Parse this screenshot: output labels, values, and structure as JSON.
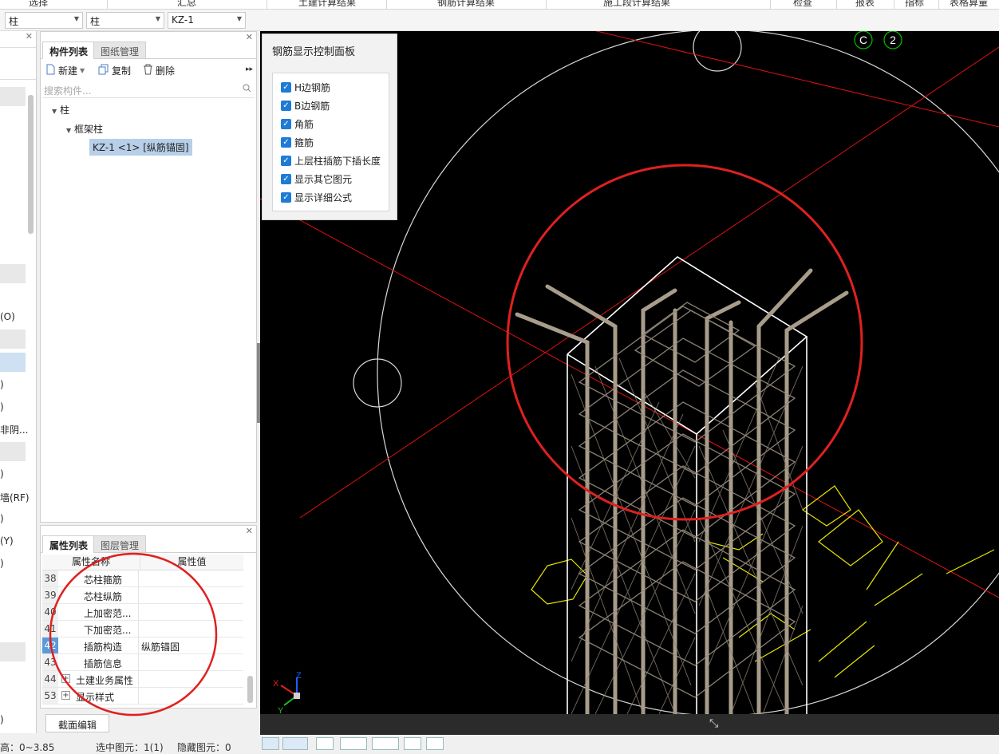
{
  "ribbon": {
    "items": [
      "选择",
      "汇总",
      "土建计算结果",
      "钢筋计算结果",
      "施工段计算结果",
      "检查",
      "报表",
      "指标",
      "表格算量"
    ]
  },
  "combos": {
    "floor": "柱",
    "type": "柱",
    "component": "KZ-1"
  },
  "left_panel": {
    "items": [
      "(O)",
      ")",
      ")",
      "非阴...",
      ")",
      "墙(RF)",
      ")",
      "(Y)",
      ")",
      ")"
    ]
  },
  "component_list": {
    "tabs": [
      "构件列表",
      "图纸管理"
    ],
    "toolbar": {
      "new": "新建",
      "copy": "复制",
      "delete": "删除",
      "more": "▸▸"
    },
    "search_placeholder": "搜索构件...",
    "tree": {
      "root": "柱",
      "child": "框架柱",
      "leaf": "KZ-1 <1> [纵筋锚固]"
    }
  },
  "properties": {
    "tabs": [
      "属性列表",
      "图层管理"
    ],
    "headers": {
      "name": "属性名称",
      "value": "属性值"
    },
    "rows": [
      {
        "num": "38",
        "name": "芯柱箍筋",
        "value": ""
      },
      {
        "num": "39",
        "name": "芯柱纵筋",
        "value": ""
      },
      {
        "num": "40",
        "name": "上加密范...",
        "value": ""
      },
      {
        "num": "41",
        "name": "下加密范...",
        "value": ""
      },
      {
        "num": "42",
        "name": "插筋构造",
        "value": "纵筋锚固"
      },
      {
        "num": "43",
        "name": "插筋信息",
        "value": ""
      },
      {
        "num": "44",
        "name": "土建业务属性",
        "value": ""
      },
      {
        "num": "53",
        "name": "显示样式",
        "value": ""
      }
    ]
  },
  "section_edit_label": "截面编辑",
  "control_panel": {
    "title": "钢筋显示控制面板",
    "options": [
      "H边钢筋",
      "B边钢筋",
      "角筋",
      "箍筋",
      "上层柱插筋下插长度",
      "显示其它图元",
      "显示详细公式"
    ]
  },
  "viewport": {
    "axis_labels": [
      "C",
      "2"
    ],
    "coord_axes": [
      "X",
      "Y",
      "Z"
    ],
    "colors": {
      "background": "#000000",
      "rebar": "#a89c8a",
      "axis_line": "#e01010",
      "highlight_circle": "#e02020",
      "annotation": "#e6e600"
    }
  },
  "status": {
    "elevation": "高：0~3.85",
    "selected": "选中图元：1(1)",
    "hidden": "隐藏图元：0"
  }
}
